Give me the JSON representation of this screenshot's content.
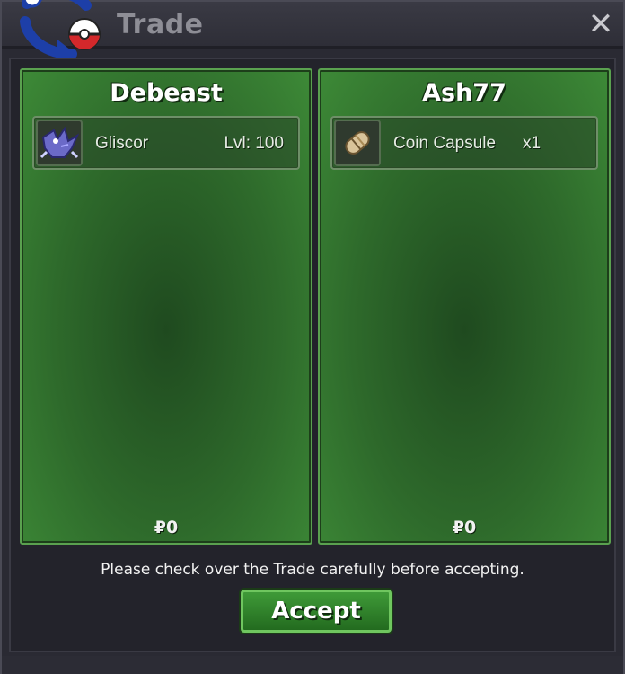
{
  "window": {
    "title": "Trade",
    "close_glyph": "✕"
  },
  "panels": [
    {
      "player": "Debeast",
      "items": [
        {
          "name": "Gliscor",
          "extra": "Lvl: 100",
          "icon": "gliscor-sprite-icon"
        }
      ],
      "money": "₽0"
    },
    {
      "player": "Ash77",
      "items": [
        {
          "name": "Coin Capsule",
          "extra": "x1",
          "icon": "coin-capsule-icon"
        }
      ],
      "money": "₽0"
    }
  ],
  "footer": {
    "notice": "Please check over the Trade carefully before accepting.",
    "accept_label": "Accept"
  },
  "colors": {
    "panel_green": "#2e6a2b",
    "accept_green": "#3f9a38",
    "title_gray": "#8e8e96"
  }
}
